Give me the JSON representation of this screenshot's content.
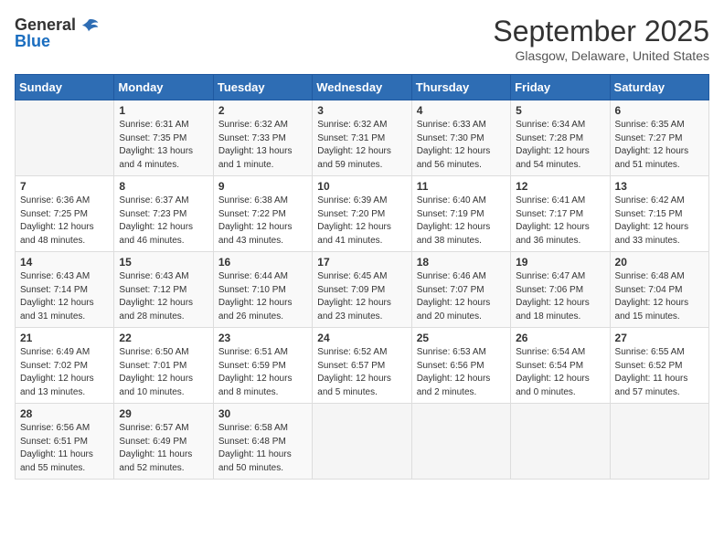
{
  "logo": {
    "general": "General",
    "blue": "Blue"
  },
  "title": "September 2025",
  "location": "Glasgow, Delaware, United States",
  "days_of_week": [
    "Sunday",
    "Monday",
    "Tuesday",
    "Wednesday",
    "Thursday",
    "Friday",
    "Saturday"
  ],
  "weeks": [
    [
      {
        "day": "",
        "info": ""
      },
      {
        "day": "1",
        "info": "Sunrise: 6:31 AM\nSunset: 7:35 PM\nDaylight: 13 hours\nand 4 minutes."
      },
      {
        "day": "2",
        "info": "Sunrise: 6:32 AM\nSunset: 7:33 PM\nDaylight: 13 hours\nand 1 minute."
      },
      {
        "day": "3",
        "info": "Sunrise: 6:32 AM\nSunset: 7:31 PM\nDaylight: 12 hours\nand 59 minutes."
      },
      {
        "day": "4",
        "info": "Sunrise: 6:33 AM\nSunset: 7:30 PM\nDaylight: 12 hours\nand 56 minutes."
      },
      {
        "day": "5",
        "info": "Sunrise: 6:34 AM\nSunset: 7:28 PM\nDaylight: 12 hours\nand 54 minutes."
      },
      {
        "day": "6",
        "info": "Sunrise: 6:35 AM\nSunset: 7:27 PM\nDaylight: 12 hours\nand 51 minutes."
      }
    ],
    [
      {
        "day": "7",
        "info": "Sunrise: 6:36 AM\nSunset: 7:25 PM\nDaylight: 12 hours\nand 48 minutes."
      },
      {
        "day": "8",
        "info": "Sunrise: 6:37 AM\nSunset: 7:23 PM\nDaylight: 12 hours\nand 46 minutes."
      },
      {
        "day": "9",
        "info": "Sunrise: 6:38 AM\nSunset: 7:22 PM\nDaylight: 12 hours\nand 43 minutes."
      },
      {
        "day": "10",
        "info": "Sunrise: 6:39 AM\nSunset: 7:20 PM\nDaylight: 12 hours\nand 41 minutes."
      },
      {
        "day": "11",
        "info": "Sunrise: 6:40 AM\nSunset: 7:19 PM\nDaylight: 12 hours\nand 38 minutes."
      },
      {
        "day": "12",
        "info": "Sunrise: 6:41 AM\nSunset: 7:17 PM\nDaylight: 12 hours\nand 36 minutes."
      },
      {
        "day": "13",
        "info": "Sunrise: 6:42 AM\nSunset: 7:15 PM\nDaylight: 12 hours\nand 33 minutes."
      }
    ],
    [
      {
        "day": "14",
        "info": "Sunrise: 6:43 AM\nSunset: 7:14 PM\nDaylight: 12 hours\nand 31 minutes."
      },
      {
        "day": "15",
        "info": "Sunrise: 6:43 AM\nSunset: 7:12 PM\nDaylight: 12 hours\nand 28 minutes."
      },
      {
        "day": "16",
        "info": "Sunrise: 6:44 AM\nSunset: 7:10 PM\nDaylight: 12 hours\nand 26 minutes."
      },
      {
        "day": "17",
        "info": "Sunrise: 6:45 AM\nSunset: 7:09 PM\nDaylight: 12 hours\nand 23 minutes."
      },
      {
        "day": "18",
        "info": "Sunrise: 6:46 AM\nSunset: 7:07 PM\nDaylight: 12 hours\nand 20 minutes."
      },
      {
        "day": "19",
        "info": "Sunrise: 6:47 AM\nSunset: 7:06 PM\nDaylight: 12 hours\nand 18 minutes."
      },
      {
        "day": "20",
        "info": "Sunrise: 6:48 AM\nSunset: 7:04 PM\nDaylight: 12 hours\nand 15 minutes."
      }
    ],
    [
      {
        "day": "21",
        "info": "Sunrise: 6:49 AM\nSunset: 7:02 PM\nDaylight: 12 hours\nand 13 minutes."
      },
      {
        "day": "22",
        "info": "Sunrise: 6:50 AM\nSunset: 7:01 PM\nDaylight: 12 hours\nand 10 minutes."
      },
      {
        "day": "23",
        "info": "Sunrise: 6:51 AM\nSunset: 6:59 PM\nDaylight: 12 hours\nand 8 minutes."
      },
      {
        "day": "24",
        "info": "Sunrise: 6:52 AM\nSunset: 6:57 PM\nDaylight: 12 hours\nand 5 minutes."
      },
      {
        "day": "25",
        "info": "Sunrise: 6:53 AM\nSunset: 6:56 PM\nDaylight: 12 hours\nand 2 minutes."
      },
      {
        "day": "26",
        "info": "Sunrise: 6:54 AM\nSunset: 6:54 PM\nDaylight: 12 hours\nand 0 minutes."
      },
      {
        "day": "27",
        "info": "Sunrise: 6:55 AM\nSunset: 6:52 PM\nDaylight: 11 hours\nand 57 minutes."
      }
    ],
    [
      {
        "day": "28",
        "info": "Sunrise: 6:56 AM\nSunset: 6:51 PM\nDaylight: 11 hours\nand 55 minutes."
      },
      {
        "day": "29",
        "info": "Sunrise: 6:57 AM\nSunset: 6:49 PM\nDaylight: 11 hours\nand 52 minutes."
      },
      {
        "day": "30",
        "info": "Sunrise: 6:58 AM\nSunset: 6:48 PM\nDaylight: 11 hours\nand 50 minutes."
      },
      {
        "day": "",
        "info": ""
      },
      {
        "day": "",
        "info": ""
      },
      {
        "day": "",
        "info": ""
      },
      {
        "day": "",
        "info": ""
      }
    ]
  ]
}
